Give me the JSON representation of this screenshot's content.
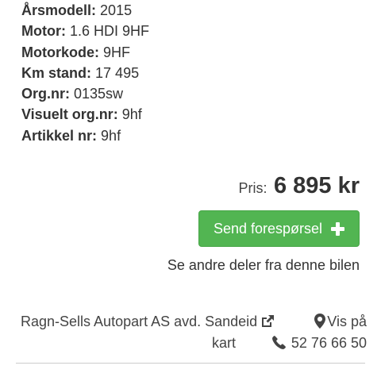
{
  "specs": [
    {
      "key": "Årsmodell:",
      "value": "2015"
    },
    {
      "key": "Motor:",
      "value": "1.6 HDI 9HF"
    },
    {
      "key": "Motorkode:",
      "value": "9HF"
    },
    {
      "key": "Km stand:",
      "value": "17 495"
    },
    {
      "key": "Org.nr:",
      "value": "0135sw"
    },
    {
      "key": "Visuelt org.nr:",
      "value": "9hf"
    },
    {
      "key": "Artikkel nr:",
      "value": "9hf"
    }
  ],
  "price": {
    "label": "Pris:",
    "value": "6 895 kr"
  },
  "send_button": {
    "label": "Send forespørsel",
    "icon": "plus-icon",
    "color": "#52b552"
  },
  "other_parts_link": "Se andre deler fra denne bilen",
  "seller": {
    "name": "Ragn-Sells Autopart AS avd. Sandeid",
    "name_icon": "external-link-icon",
    "map_label_part1": "Vis på",
    "map_label_part2": "kart",
    "map_icon": "map-marker-icon",
    "phone": "52 76 66 50",
    "phone_icon": "phone-icon"
  }
}
